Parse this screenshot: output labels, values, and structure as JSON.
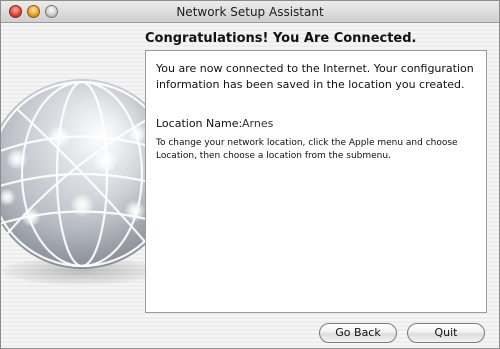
{
  "window": {
    "title": "Network Setup Assistant"
  },
  "heading": "Congratulations! You Are Connected.",
  "panel": {
    "intro": "You are now connected to the Internet. Your configuration information has been saved in the location you created.",
    "location_label": "Location Name:",
    "location_value": "Arnes",
    "help": "To change your network location, click the Apple menu and choose Location, then choose a location from the submenu."
  },
  "buttons": {
    "back": "Go Back",
    "quit": "Quit"
  }
}
